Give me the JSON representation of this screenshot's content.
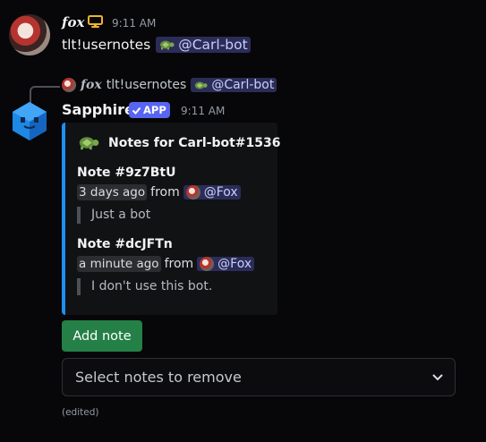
{
  "message1": {
    "author": "fox",
    "time": "9:11 AM",
    "text": "tlt!usernotes",
    "mention": "@Carl-bot",
    "icons": [
      "desktop-icon",
      "turtle-icon"
    ]
  },
  "reply": {
    "author": "fox",
    "text": "tlt!usernotes",
    "mention": "@Carl-bot"
  },
  "message2": {
    "author": "Sapphire",
    "badge": "APP",
    "time": "9:11 AM"
  },
  "embed": {
    "accent": "#1f8ff0",
    "title": "Notes for Carl-bot#1536",
    "notes": [
      {
        "title": "Note #9z7BtU",
        "when": "3 days ago",
        "from_label": "from",
        "by": "@Fox",
        "content": "Just a bot"
      },
      {
        "title": "Note #dcJFTn",
        "when": "a minute ago",
        "from_label": "from",
        "by": "@Fox",
        "content": "I don't use this bot."
      }
    ]
  },
  "components": {
    "add_button": "Add note",
    "add_button_color": "#248046",
    "select_placeholder": "Select notes to remove"
  },
  "edited_label": "(edited)"
}
